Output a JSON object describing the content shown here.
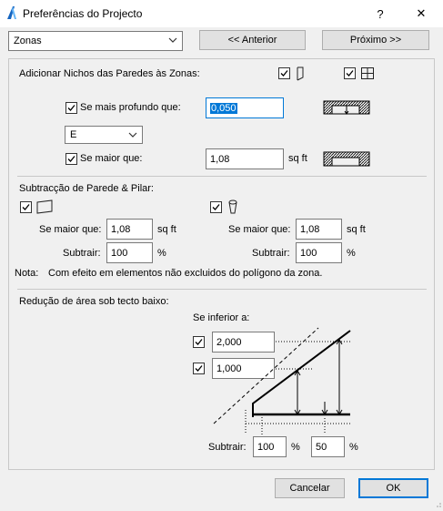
{
  "window": {
    "title": "Preferências do Projecto",
    "help_glyph": "?",
    "close_glyph": "✕"
  },
  "nav": {
    "category_value": "Zonas",
    "prev_label": "<< Anterior",
    "next_label": "Próximo >>"
  },
  "niches": {
    "heading": "Adicionar Nichos das Paredes às Zonas:",
    "deeper_label": "Se mais profundo que:",
    "deeper_value": "0,050",
    "dropdown_value": "E",
    "larger_label": "Se maior que:",
    "larger_value": "1,08",
    "larger_unit": "sq ft"
  },
  "subtraction": {
    "heading": "Subtracção de Parede & Pilar:",
    "left_larger_label": "Se maior que:",
    "left_larger_value": "1,08",
    "left_larger_unit": "sq ft",
    "left_subtract_label": "Subtrair:",
    "left_subtract_value": "100",
    "left_subtract_unit": "%",
    "right_larger_label": "Se maior que:",
    "right_larger_value": "1,08",
    "right_larger_unit": "sq ft",
    "right_subtract_label": "Subtrair:",
    "right_subtract_value": "100",
    "right_subtract_unit": "%",
    "note_label": "Nota:",
    "note_text": "Com efeito em elementos não excluidos do polígono da zona."
  },
  "low_ceiling": {
    "heading": "Redução de área sob tecto baixo:",
    "if_lower_label": "Se inferior a:",
    "height1_value": "2,000",
    "height2_value": "1,000",
    "subtract_label": "Subtrair:",
    "subtract1_value": "100",
    "subtract1_unit": "%",
    "subtract2_value": "50",
    "subtract2_unit": "%"
  },
  "footer": {
    "cancel_label": "Cancelar",
    "ok_label": "OK"
  },
  "colors": {
    "focus_blue": "#0078d7",
    "panel_border": "#c8c8c8"
  }
}
